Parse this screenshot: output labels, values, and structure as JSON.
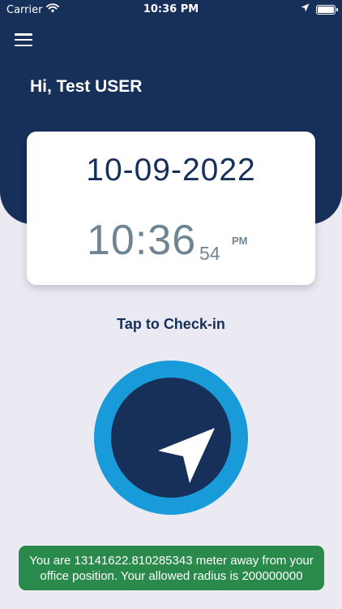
{
  "status_bar": {
    "carrier": "Carrier",
    "time": "10:36 PM"
  },
  "header": {
    "greeting": "Hi, Test USER"
  },
  "datetime_card": {
    "date": "10-09-2022",
    "time": "10:36",
    "seconds": "54",
    "ampm": "PM"
  },
  "checkin": {
    "label": "Tap to Check-in"
  },
  "toast": {
    "message": "You are 13141622.810285343 meter away from your office position. Your allowed radius is 200000000"
  },
  "colors": {
    "primary_navy": "#17305a",
    "accent_blue": "#1a9bd9",
    "toast_green": "#2a8a4b",
    "background": "#ebe9f2"
  },
  "icons": {
    "menu": "hamburger-menu-icon",
    "checkin": "navigation-arrow-icon",
    "wifi": "wifi-icon",
    "location": "location-arrow-icon",
    "battery": "battery-icon"
  }
}
